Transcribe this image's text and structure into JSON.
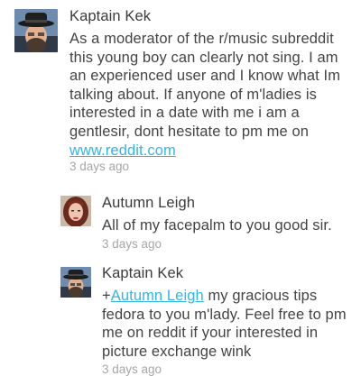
{
  "comments": [
    {
      "author": "Kaptain Kek",
      "lines": [
        "As a moderator of the r/music subreddit",
        "this young boy can clearly not sing. I am",
        "an experienced user and I know what Im",
        "talking about. If anyone of m'ladies is",
        "interested in a date with me i am a",
        "gentlesir, dont hesitate to pm me on"
      ],
      "link_text": "www.reddit.com",
      "time": "3 days ago",
      "avatar_icon": "fedora-man-avatar"
    },
    {
      "author": "Autumn Leigh",
      "lines": [
        "All of my facepalm to you good sir."
      ],
      "time": "3 days ago",
      "avatar_icon": "woman-avatar"
    },
    {
      "author": "Kaptain Kek",
      "mention_prefix": "+",
      "mention": "Autumn Leigh",
      "first_line_rest": " my gracious tips",
      "lines": [
        "fedora to you m'lady. Feel free to pm",
        "me on reddit if your interested in",
        "picture exchange wink"
      ],
      "time": "3 days ago",
      "avatar_icon": "fedora-man-avatar"
    }
  ],
  "colors": {
    "link": "#33b5e5",
    "timestamp": "#a6a6a6",
    "author": "#3b3b3b"
  }
}
